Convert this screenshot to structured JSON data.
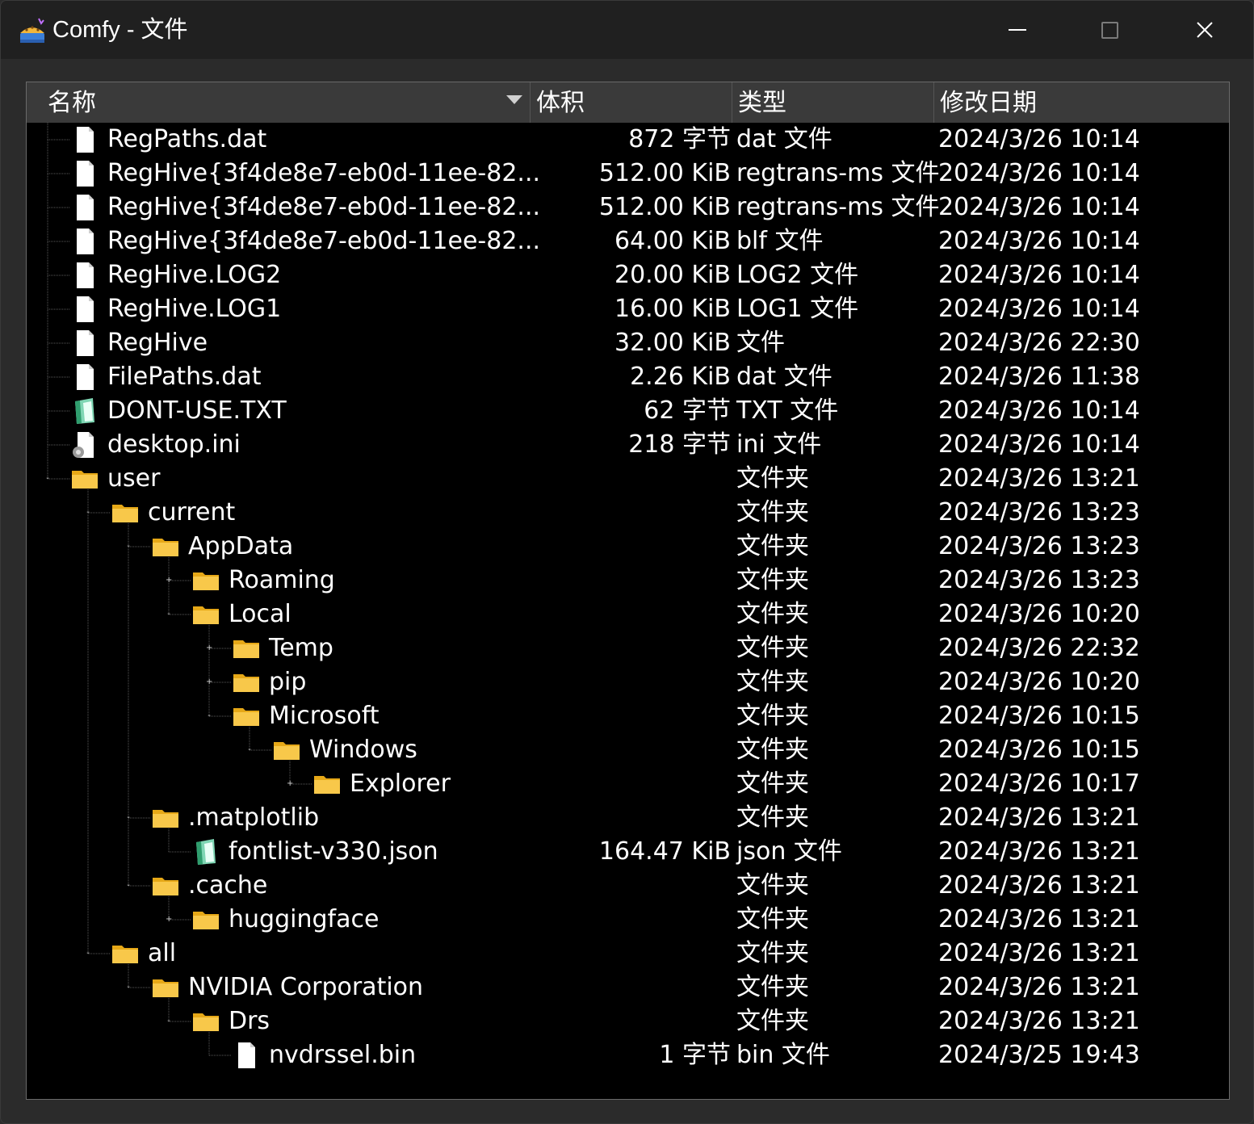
{
  "window": {
    "title": "Comfy - 文件",
    "minimize_label": "",
    "maximize_label": "",
    "close_label": ""
  },
  "columns": {
    "name": "名称",
    "size": "体积",
    "type": "类型",
    "date": "修改日期"
  },
  "rows": [
    {
      "name": "RegPaths.dat",
      "size": "872 字节",
      "type": "dat 文件",
      "date": "2024/3/26 10:14",
      "icon": "file-icon",
      "depth": 1,
      "expander": ""
    },
    {
      "name": "RegHive{3f4de8e7-eb0d-11ee-82...",
      "size": "512.00 KiB",
      "type": "regtrans-ms 文件",
      "date": "2024/3/26 10:14",
      "icon": "file-icon",
      "depth": 1,
      "expander": ""
    },
    {
      "name": "RegHive{3f4de8e7-eb0d-11ee-82...",
      "size": "512.00 KiB",
      "type": "regtrans-ms 文件",
      "date": "2024/3/26 10:14",
      "icon": "file-icon",
      "depth": 1,
      "expander": ""
    },
    {
      "name": "RegHive{3f4de8e7-eb0d-11ee-82...",
      "size": "64.00 KiB",
      "type": "blf 文件",
      "date": "2024/3/26 10:14",
      "icon": "file-icon",
      "depth": 1,
      "expander": ""
    },
    {
      "name": "RegHive.LOG2",
      "size": "20.00 KiB",
      "type": "LOG2 文件",
      "date": "2024/3/26 10:14",
      "icon": "file-icon",
      "depth": 1,
      "expander": ""
    },
    {
      "name": "RegHive.LOG1",
      "size": "16.00 KiB",
      "type": "LOG1 文件",
      "date": "2024/3/26 10:14",
      "icon": "file-icon",
      "depth": 1,
      "expander": ""
    },
    {
      "name": "RegHive",
      "size": "32.00 KiB",
      "type": "文件",
      "date": "2024/3/26 22:30",
      "icon": "file-icon",
      "depth": 1,
      "expander": ""
    },
    {
      "name": "FilePaths.dat",
      "size": "2.26 KiB",
      "type": "dat 文件",
      "date": "2024/3/26 11:38",
      "icon": "file-icon",
      "depth": 1,
      "expander": ""
    },
    {
      "name": "DONT-USE.TXT",
      "size": "62 字节",
      "type": "TXT 文件",
      "date": "2024/3/26 10:14",
      "icon": "notepad-icon",
      "depth": 1,
      "expander": ""
    },
    {
      "name": "desktop.ini",
      "size": "218 字节",
      "type": "ini 文件",
      "date": "2024/3/26 10:14",
      "icon": "settings-file-icon",
      "depth": 1,
      "expander": ""
    },
    {
      "name": "user",
      "size": "",
      "type": "文件夹",
      "date": "2024/3/26 13:21",
      "icon": "folder-icon",
      "depth": 1,
      "expander": "-"
    },
    {
      "name": "current",
      "size": "",
      "type": "文件夹",
      "date": "2024/3/26 13:23",
      "icon": "folder-icon",
      "depth": 2,
      "expander": "-"
    },
    {
      "name": "AppData",
      "size": "",
      "type": "文件夹",
      "date": "2024/3/26 13:23",
      "icon": "folder-icon",
      "depth": 3,
      "expander": "-"
    },
    {
      "name": "Roaming",
      "size": "",
      "type": "文件夹",
      "date": "2024/3/26 13:23",
      "icon": "folder-icon",
      "depth": 4,
      "expander": "+"
    },
    {
      "name": "Local",
      "size": "",
      "type": "文件夹",
      "date": "2024/3/26 10:20",
      "icon": "folder-icon",
      "depth": 4,
      "expander": "-"
    },
    {
      "name": "Temp",
      "size": "",
      "type": "文件夹",
      "date": "2024/3/26 22:32",
      "icon": "folder-icon",
      "depth": 5,
      "expander": "+"
    },
    {
      "name": "pip",
      "size": "",
      "type": "文件夹",
      "date": "2024/3/26 10:20",
      "icon": "folder-icon",
      "depth": 5,
      "expander": "+"
    },
    {
      "name": "Microsoft",
      "size": "",
      "type": "文件夹",
      "date": "2024/3/26 10:15",
      "icon": "folder-icon",
      "depth": 5,
      "expander": "-"
    },
    {
      "name": "Windows",
      "size": "",
      "type": "文件夹",
      "date": "2024/3/26 10:15",
      "icon": "folder-icon",
      "depth": 6,
      "expander": "-"
    },
    {
      "name": "Explorer",
      "size": "",
      "type": "文件夹",
      "date": "2024/3/26 10:17",
      "icon": "folder-icon",
      "depth": 7,
      "expander": "+"
    },
    {
      "name": ".matplotlib",
      "size": "",
      "type": "文件夹",
      "date": "2024/3/26 13:21",
      "icon": "folder-icon",
      "depth": 3,
      "expander": "-"
    },
    {
      "name": "fontlist-v330.json",
      "size": "164.47 KiB",
      "type": "json 文件",
      "date": "2024/3/26 13:21",
      "icon": "notepad-icon",
      "depth": 4,
      "expander": ""
    },
    {
      "name": ".cache",
      "size": "",
      "type": "文件夹",
      "date": "2024/3/26 13:21",
      "icon": "folder-icon",
      "depth": 3,
      "expander": "-"
    },
    {
      "name": "huggingface",
      "size": "",
      "type": "文件夹",
      "date": "2024/3/26 13:21",
      "icon": "folder-icon",
      "depth": 4,
      "expander": "+"
    },
    {
      "name": "all",
      "size": "",
      "type": "文件夹",
      "date": "2024/3/26 13:21",
      "icon": "folder-icon",
      "depth": 2,
      "expander": "-"
    },
    {
      "name": "NVIDIA Corporation",
      "size": "",
      "type": "文件夹",
      "date": "2024/3/26 13:21",
      "icon": "folder-icon",
      "depth": 3,
      "expander": "-"
    },
    {
      "name": "Drs",
      "size": "",
      "type": "文件夹",
      "date": "2024/3/26 13:21",
      "icon": "folder-icon",
      "depth": 4,
      "expander": "-"
    },
    {
      "name": "nvdrssel.bin",
      "size": "1 字节",
      "type": "bin 文件",
      "date": "2024/3/25 19:43",
      "icon": "file-icon",
      "depth": 5,
      "expander": ""
    }
  ],
  "colors": {
    "folder": "#f8c84a",
    "folder_dark": "#e6a817",
    "titlebar": "#202020",
    "header": "#3a3a3a",
    "list_bg": "#000000"
  }
}
